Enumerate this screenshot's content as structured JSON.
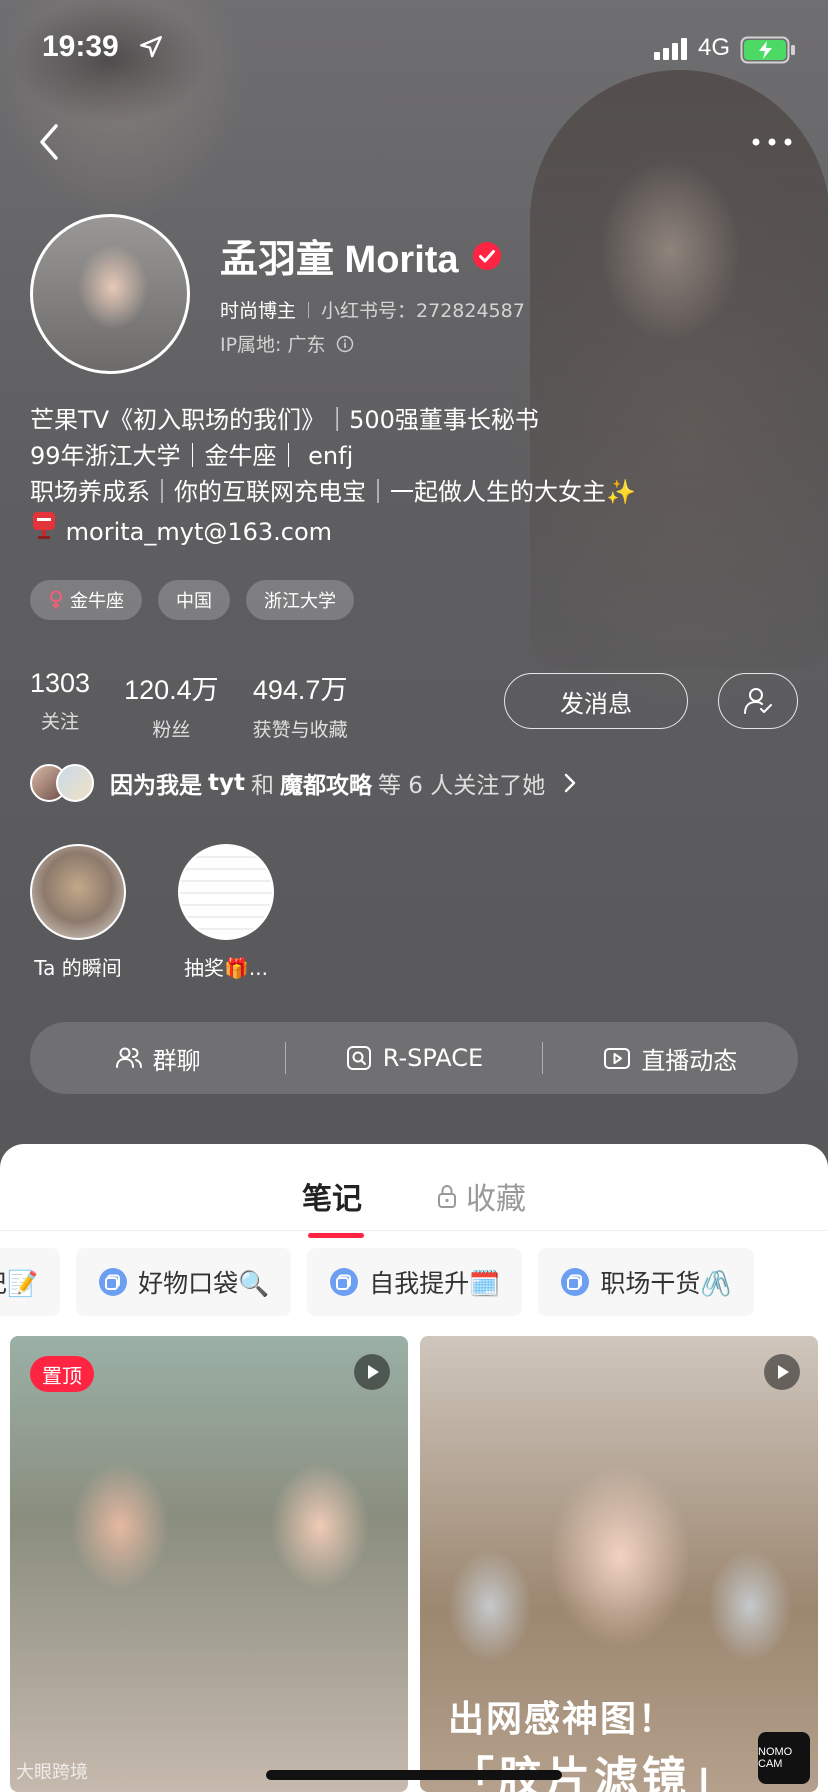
{
  "status": {
    "time": "19:39",
    "network": "4G"
  },
  "profile": {
    "name": "孟羽童 Morita",
    "role": "时尚博主",
    "red_id": "小红书号：272824587",
    "ip": "IP属地: 广东",
    "bio": [
      "芒果TV《初入职场的我们》｜500强董事长秘书",
      "99年浙江大学｜金牛座｜ enfj",
      "职场养成系｜你的互联网充电宝｜一起做人生的大女主✨",
      "morita_myt@163.com"
    ],
    "tags": [
      "金牛座",
      "中国",
      "浙江大学"
    ]
  },
  "stats": [
    {
      "value": "1303",
      "label": "关注"
    },
    {
      "value": "120.4万",
      "label": "粉丝"
    },
    {
      "value": "494.7万",
      "label": "获赞与收藏"
    }
  ],
  "buttons": {
    "message": "发消息"
  },
  "mutual": {
    "prefix": "因为我是",
    "user1": "tyt",
    "and": "和",
    "user2": "魔都攻略",
    "suffix": "等 6 人关注了她"
  },
  "moments": [
    {
      "label": "Ta 的瞬间"
    },
    {
      "label": "抽奖🎁..."
    }
  ],
  "actions": [
    {
      "label": "群聊",
      "icon": "people-icon"
    },
    {
      "label": "R-SPACE",
      "icon": "rspace-icon"
    },
    {
      "label": "直播动态",
      "icon": "live-icon"
    }
  ],
  "tabs": {
    "notes": "笔记",
    "favorites": "收藏"
  },
  "collections": [
    {
      "label": "记📝"
    },
    {
      "label": "好物口袋🔍"
    },
    {
      "label": "自我提升🗓️"
    },
    {
      "label": "职场干货🖇️"
    }
  ],
  "notes": [
    {
      "badge": "置顶"
    },
    {
      "caption1": "出网感神图！",
      "caption2": "「胶片滤镜」",
      "sticker": "NOMO CAM"
    }
  ],
  "watermark": "大眼跨境",
  "colors": {
    "accent": "#ff2442",
    "background": "#5a5a5c"
  }
}
